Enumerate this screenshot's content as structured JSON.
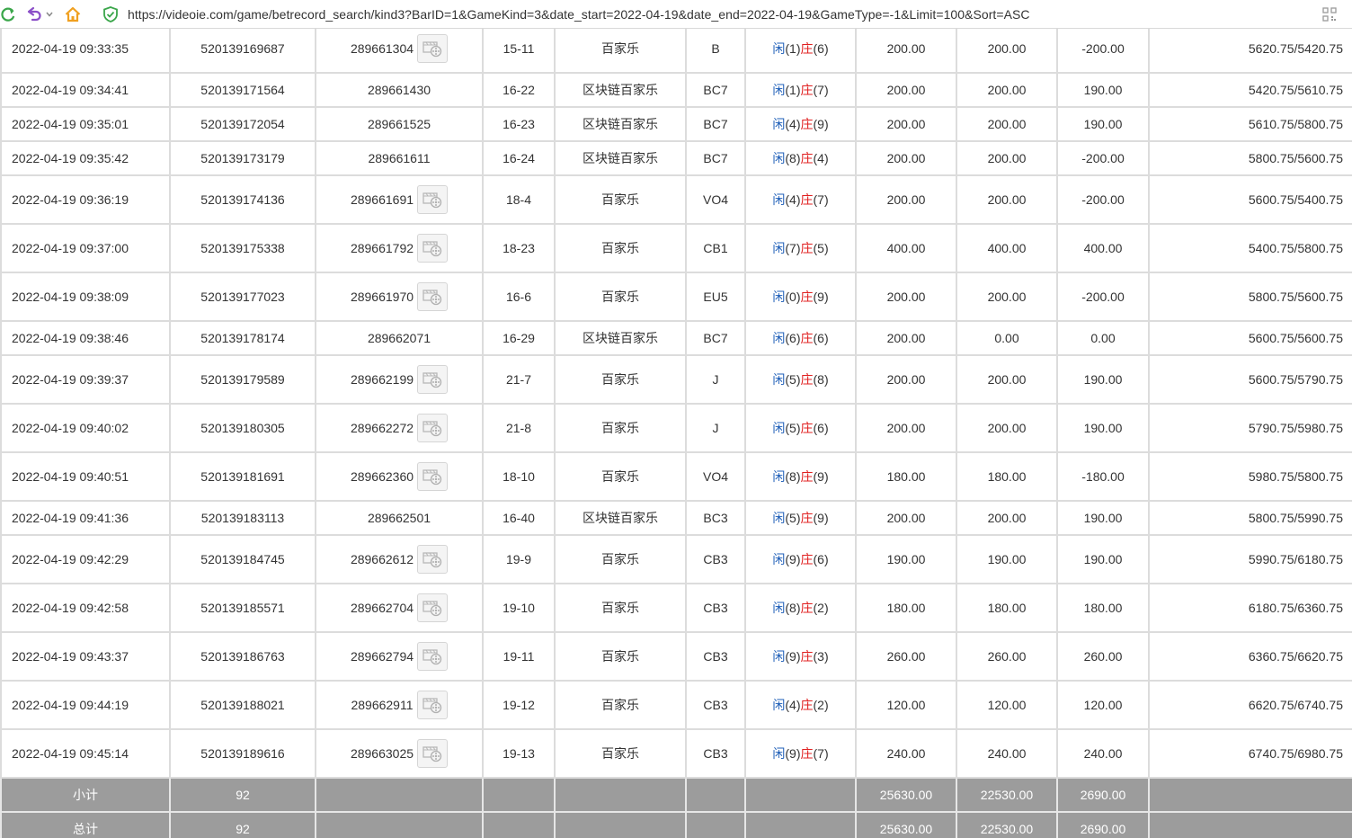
{
  "browser": {
    "url": "https://videoie.com/game/betrecord_search/kind3?BarID=1&GameKind=3&date_start=2022-04-19&date_end=2022-04-19&GameType=-1&Limit=100&Sort=ASC",
    "icons": [
      "refresh-icon",
      "undo-icon",
      "home-icon",
      "secure-shield-icon",
      "qr-code-icon"
    ],
    "colors": {
      "refresh": "#3aa64a",
      "undo": "#8b4fc8",
      "home": "#f0a020",
      "shield": "#3aa64a"
    }
  },
  "colors": {
    "amount_blue": "#1f5fb8",
    "negative_red": "#e02020",
    "total_row_bg": "#9c9c9c"
  },
  "result_labels": {
    "player": "闲",
    "banker": "庄"
  },
  "rows": [
    {
      "time": "2022-04-19 09:33:35",
      "bet_id": "520139169687",
      "round_id": "289661304",
      "video": true,
      "shoe": "15-11",
      "game": "百家乐",
      "table": "B",
      "player": "1",
      "banker": "6",
      "bet": "200.00",
      "valid": "200.00",
      "payout": "-200.00",
      "payout_negative": true,
      "balance": "5620.75/5420.75"
    },
    {
      "time": "2022-04-19 09:34:41",
      "bet_id": "520139171564",
      "round_id": "289661430",
      "video": false,
      "shoe": "16-22",
      "game": "区块链百家乐",
      "table": "BC7",
      "player": "1",
      "banker": "7",
      "bet": "200.00",
      "valid": "200.00",
      "payout": "190.00",
      "payout_negative": false,
      "balance": "5420.75/5610.75"
    },
    {
      "time": "2022-04-19 09:35:01",
      "bet_id": "520139172054",
      "round_id": "289661525",
      "video": false,
      "shoe": "16-23",
      "game": "区块链百家乐",
      "table": "BC7",
      "player": "4",
      "banker": "9",
      "bet": "200.00",
      "valid": "200.00",
      "payout": "190.00",
      "payout_negative": false,
      "balance": "5610.75/5800.75"
    },
    {
      "time": "2022-04-19 09:35:42",
      "bet_id": "520139173179",
      "round_id": "289661611",
      "video": false,
      "shoe": "16-24",
      "game": "区块链百家乐",
      "table": "BC7",
      "player": "8",
      "banker": "4",
      "bet": "200.00",
      "valid": "200.00",
      "payout": "-200.00",
      "payout_negative": true,
      "balance": "5800.75/5600.75"
    },
    {
      "time": "2022-04-19 09:36:19",
      "bet_id": "520139174136",
      "round_id": "289661691",
      "video": true,
      "shoe": "18-4",
      "game": "百家乐",
      "table": "VO4",
      "player": "4",
      "banker": "7",
      "bet": "200.00",
      "valid": "200.00",
      "payout": "-200.00",
      "payout_negative": true,
      "balance": "5600.75/5400.75"
    },
    {
      "time": "2022-04-19 09:37:00",
      "bet_id": "520139175338",
      "round_id": "289661792",
      "video": true,
      "shoe": "18-23",
      "game": "百家乐",
      "table": "CB1",
      "player": "7",
      "banker": "5",
      "bet": "400.00",
      "valid": "400.00",
      "payout": "400.00",
      "payout_negative": false,
      "balance": "5400.75/5800.75"
    },
    {
      "time": "2022-04-19 09:38:09",
      "bet_id": "520139177023",
      "round_id": "289661970",
      "video": true,
      "shoe": "16-6",
      "game": "百家乐",
      "table": "EU5",
      "player": "0",
      "banker": "9",
      "bet": "200.00",
      "valid": "200.00",
      "payout": "-200.00",
      "payout_negative": true,
      "balance": "5800.75/5600.75"
    },
    {
      "time": "2022-04-19 09:38:46",
      "bet_id": "520139178174",
      "round_id": "289662071",
      "video": false,
      "shoe": "16-29",
      "game": "区块链百家乐",
      "table": "BC7",
      "player": "6",
      "banker": "6",
      "bet": "200.00",
      "valid": "0.00",
      "payout": "0.00",
      "payout_negative": false,
      "balance": "5600.75/5600.75"
    },
    {
      "time": "2022-04-19 09:39:37",
      "bet_id": "520139179589",
      "round_id": "289662199",
      "video": true,
      "shoe": "21-7",
      "game": "百家乐",
      "table": "J",
      "player": "5",
      "banker": "8",
      "bet": "200.00",
      "valid": "200.00",
      "payout": "190.00",
      "payout_negative": false,
      "balance": "5600.75/5790.75"
    },
    {
      "time": "2022-04-19 09:40:02",
      "bet_id": "520139180305",
      "round_id": "289662272",
      "video": true,
      "shoe": "21-8",
      "game": "百家乐",
      "table": "J",
      "player": "5",
      "banker": "6",
      "bet": "200.00",
      "valid": "200.00",
      "payout": "190.00",
      "payout_negative": false,
      "balance": "5790.75/5980.75"
    },
    {
      "time": "2022-04-19 09:40:51",
      "bet_id": "520139181691",
      "round_id": "289662360",
      "video": true,
      "shoe": "18-10",
      "game": "百家乐",
      "table": "VO4",
      "player": "8",
      "banker": "9",
      "bet": "180.00",
      "valid": "180.00",
      "payout": "-180.00",
      "payout_negative": true,
      "balance": "5980.75/5800.75"
    },
    {
      "time": "2022-04-19 09:41:36",
      "bet_id": "520139183113",
      "round_id": "289662501",
      "video": false,
      "shoe": "16-40",
      "game": "区块链百家乐",
      "table": "BC3",
      "player": "5",
      "banker": "9",
      "bet": "200.00",
      "valid": "200.00",
      "payout": "190.00",
      "payout_negative": false,
      "balance": "5800.75/5990.75"
    },
    {
      "time": "2022-04-19 09:42:29",
      "bet_id": "520139184745",
      "round_id": "289662612",
      "video": true,
      "shoe": "19-9",
      "game": "百家乐",
      "table": "CB3",
      "player": "9",
      "banker": "6",
      "bet": "190.00",
      "valid": "190.00",
      "payout": "190.00",
      "payout_negative": false,
      "balance": "5990.75/6180.75"
    },
    {
      "time": "2022-04-19 09:42:58",
      "bet_id": "520139185571",
      "round_id": "289662704",
      "video": true,
      "shoe": "19-10",
      "game": "百家乐",
      "table": "CB3",
      "player": "8",
      "banker": "2",
      "bet": "180.00",
      "valid": "180.00",
      "payout": "180.00",
      "payout_negative": false,
      "balance": "6180.75/6360.75"
    },
    {
      "time": "2022-04-19 09:43:37",
      "bet_id": "520139186763",
      "round_id": "289662794",
      "video": true,
      "shoe": "19-11",
      "game": "百家乐",
      "table": "CB3",
      "player": "9",
      "banker": "3",
      "bet": "260.00",
      "valid": "260.00",
      "payout": "260.00",
      "payout_negative": false,
      "balance": "6360.75/6620.75"
    },
    {
      "time": "2022-04-19 09:44:19",
      "bet_id": "520139188021",
      "round_id": "289662911",
      "video": true,
      "shoe": "19-12",
      "game": "百家乐",
      "table": "CB3",
      "player": "4",
      "banker": "2",
      "bet": "120.00",
      "valid": "120.00",
      "payout": "120.00",
      "payout_negative": false,
      "balance": "6620.75/6740.75"
    },
    {
      "time": "2022-04-19 09:45:14",
      "bet_id": "520139189616",
      "round_id": "289663025",
      "video": true,
      "shoe": "19-13",
      "game": "百家乐",
      "table": "CB3",
      "player": "9",
      "banker": "7",
      "bet": "240.00",
      "valid": "240.00",
      "payout": "240.00",
      "payout_negative": false,
      "balance": "6740.75/6980.75"
    }
  ],
  "totals": [
    {
      "label": "小计",
      "count": "92",
      "bet": "25630.00",
      "valid": "22530.00",
      "payout": "2690.00"
    },
    {
      "label": "总计",
      "count": "92",
      "bet": "25630.00",
      "valid": "22530.00",
      "payout": "2690.00"
    }
  ]
}
